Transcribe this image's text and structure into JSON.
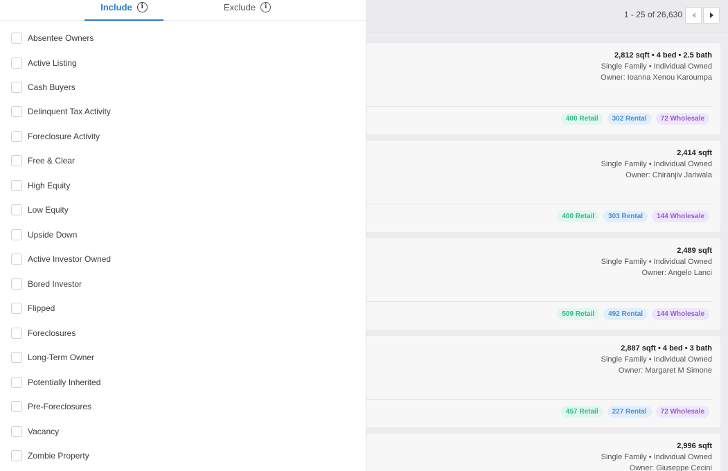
{
  "tabs": {
    "include_label": "Include",
    "exclude_label": "Exclude",
    "info_glyph": "i"
  },
  "filters": [
    "Absentee Owners",
    "Active Listing",
    "Cash Buyers",
    "Delinquent Tax Activity",
    "Foreclosure Activity",
    "Free & Clear",
    "High Equity",
    "Low Equity",
    "Upside Down",
    "Active Investor Owned",
    "Bored Investor",
    "Flipped",
    "Foreclosures",
    "Long-Term Owner",
    "Potentially Inherited",
    "Pre-Foreclosures",
    "Vacancy",
    "Zombie Property"
  ],
  "pager": {
    "text": "1 - 25 of 26,630"
  },
  "cards": [
    {
      "line1": "2,812 sqft • 4 bed • 2.5 bath",
      "line2": "Single Family • Individual Owned",
      "line3": "Owner: Ioanna Xenou Karoumpa",
      "retail": "400 Retail",
      "rental": "302 Rental",
      "wholesale": "72 Wholesale"
    },
    {
      "line1": "2,414 sqft",
      "line2": "Single Family • Individual Owned",
      "line3": "Owner: Chiranjiv Jariwala",
      "retail": "400 Retail",
      "rental": "303 Rental",
      "wholesale": "144 Wholesale"
    },
    {
      "line1": "2,489 sqft",
      "line2": "Single Family • Individual Owned",
      "line3": "Owner: Angelo Lanci",
      "retail": "509 Retail",
      "rental": "492 Rental",
      "wholesale": "144 Wholesale"
    },
    {
      "line1": "2,887 sqft • 4 bed • 3 bath",
      "line2": "Single Family • Individual Owned",
      "line3": "Owner: Margaret M Simone",
      "retail": "457 Retail",
      "rental": "227 Rental",
      "wholesale": "72 Wholesale"
    },
    {
      "line1": "2,996 sqft",
      "line2": "Single Family • Individual Owned",
      "line3": "Owner: Giuseppe Cecini",
      "retail": "",
      "rental": "",
      "wholesale": ""
    }
  ],
  "colors": {
    "accent": "#2b7cc9",
    "retail": "#2fb893",
    "rental": "#4a8fd8",
    "wholesale": "#9a5cd6"
  }
}
